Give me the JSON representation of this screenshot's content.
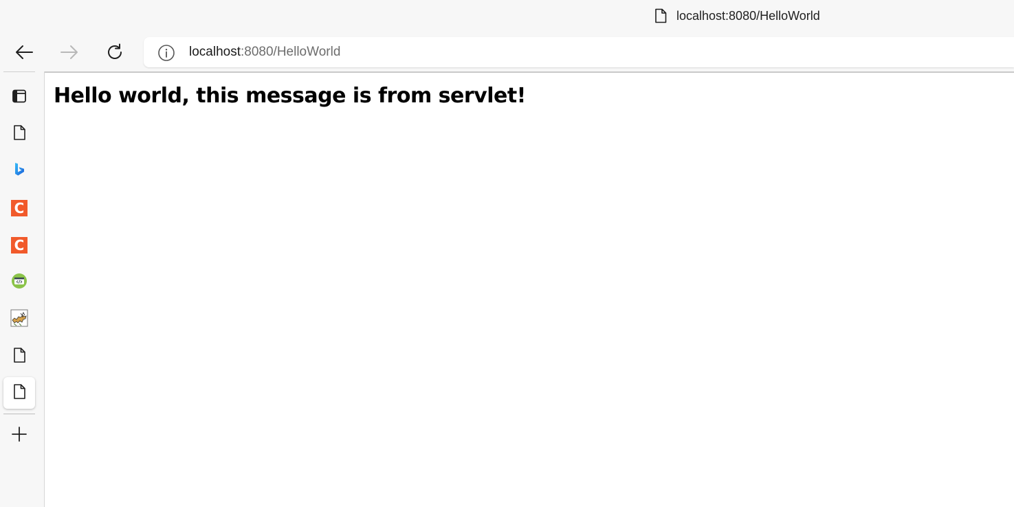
{
  "window": {
    "title": "localhost:8080/HelloWorld"
  },
  "toolbar": {
    "back_icon": "arrow-left",
    "forward_icon": "arrow-right",
    "reload_icon": "refresh",
    "address": {
      "info_icon": "info-circle",
      "host": "localhost",
      "rest": ":8080/HelloWorld"
    }
  },
  "sidebar": {
    "tabs": [
      {
        "icon": "tab-actions-icon"
      },
      {
        "icon": "page-icon"
      },
      {
        "icon": "bing-icon"
      },
      {
        "icon": "c-icon",
        "letter": "C"
      },
      {
        "icon": "c-icon",
        "letter": "C"
      },
      {
        "icon": "code-badge-icon"
      },
      {
        "icon": "tomcat-icon"
      },
      {
        "icon": "page-icon"
      },
      {
        "icon": "page-icon",
        "active": true
      }
    ],
    "new_tab_icon": "plus"
  },
  "page": {
    "heading": "Hello world, this message is from servlet!"
  },
  "colors": {
    "chrome_bg": "#f7f7f7",
    "content_bg": "#ffffff",
    "c_icon": "#f15a2b",
    "muted_url": "#6d6d6d"
  }
}
